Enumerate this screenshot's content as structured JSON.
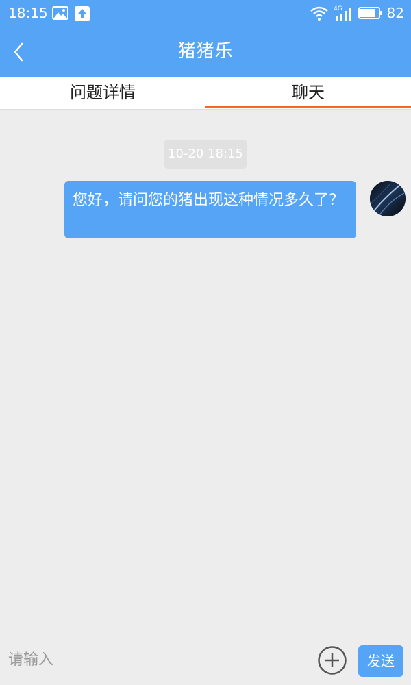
{
  "status_bar": {
    "time": "18:15",
    "network_label": "4G",
    "battery_level": "82",
    "battery_fraction": 0.82,
    "icons": [
      "image-icon",
      "upload-icon",
      "wifi-icon",
      "signal-icon",
      "battery-icon"
    ]
  },
  "header": {
    "title": "猪猪乐",
    "back_icon": "chevron-left-icon"
  },
  "tabs": [
    {
      "label": "问题详情",
      "active": false
    },
    {
      "label": "聊天",
      "active": true
    }
  ],
  "chat": {
    "timestamp": "10-20 18:15",
    "messages": [
      {
        "text": "您好，请问您的猪出现这种情况多久了？",
        "sender": "self"
      }
    ]
  },
  "input_bar": {
    "placeholder": "请输入",
    "value": "",
    "add_icon": "plus-circle-icon",
    "send_label": "发送"
  },
  "colors": {
    "primary": "#56a4f5",
    "tab_indicator": "#f06a23",
    "background": "#ededed"
  }
}
